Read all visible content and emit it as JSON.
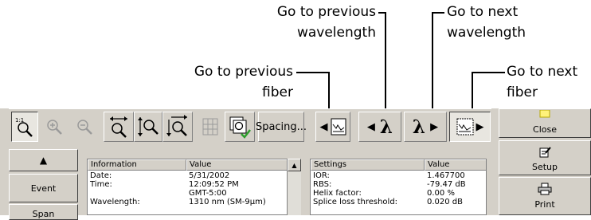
{
  "callouts": {
    "prev_wavelength": [
      "Go to previous",
      "wavelength"
    ],
    "next_wavelength": [
      "Go to next",
      "wavelength"
    ],
    "prev_fiber": [
      "Go to previous",
      "fiber"
    ],
    "next_fiber": [
      "Go to next",
      "fiber"
    ]
  },
  "toolbar": {
    "spacing_label": "Spacing...",
    "lambda": "λ"
  },
  "right_buttons": {
    "close": "Close",
    "setup": "Setup",
    "print": "Print"
  },
  "left_nav": {
    "up_arrow": "▲",
    "event": "Event",
    "span": "Span"
  },
  "info_table": {
    "headers": [
      "Information",
      "Value"
    ],
    "rows": [
      [
        "Date:",
        "5/31/2002"
      ],
      [
        "Time:",
        "12:09:52 PM"
      ],
      [
        "",
        "GMT-5:00"
      ],
      [
        "Wavelength:",
        "1310 nm (SM-9µm)"
      ]
    ]
  },
  "settings_table": {
    "headers": [
      "Settings",
      "Value"
    ],
    "rows": [
      [
        "IOR:",
        "1.467700"
      ],
      [
        "RBS:",
        "-79.47 dB"
      ],
      [
        "Helix factor:",
        "0.00 %"
      ],
      [
        "Splice loss threshold:",
        "0.020 dB"
      ]
    ]
  },
  "colors": {
    "chrome": "#d4d0c8",
    "accent_green": "#2e9e2e",
    "note_yellow": "#fff27a"
  },
  "icons": [
    "zoom-1to1-icon",
    "zoom-in-icon",
    "zoom-out-icon",
    "zoom-horizontal-icon",
    "zoom-vertical-icon",
    "zoom-both-icon",
    "grid-icon",
    "check-zoom-icon",
    "fiber-trace-icon",
    "lambda-icon",
    "note-icon",
    "edit-icon",
    "printer-icon"
  ]
}
